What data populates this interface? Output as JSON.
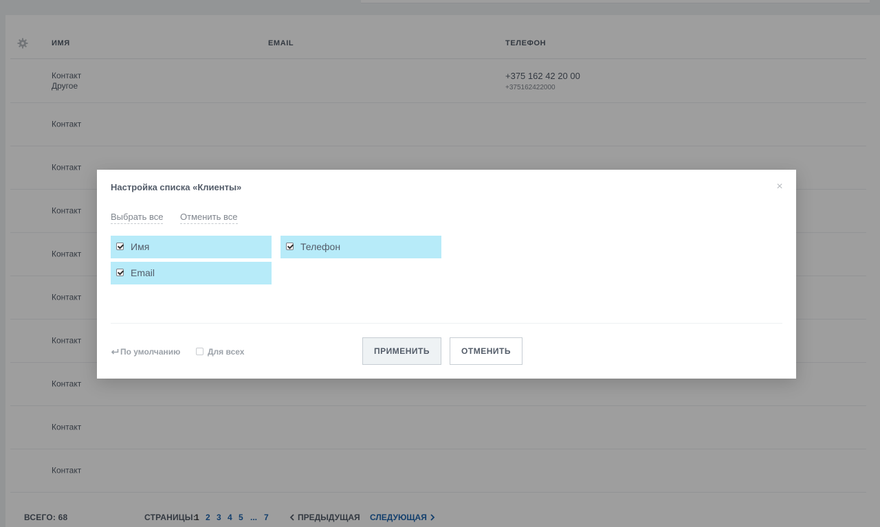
{
  "grid": {
    "columns": {
      "name": "Имя",
      "email": "Email",
      "phone": "Телефон"
    },
    "rows": [
      {
        "name": "Контакт",
        "sub": "Другое",
        "phone": "+375 162 42 20 00",
        "phone_sub": "+375162422000"
      },
      {
        "name": "Контакт"
      },
      {
        "name": "Контакт"
      },
      {
        "name": "Контакт"
      },
      {
        "name": "Контакт"
      },
      {
        "name": "Контакт"
      },
      {
        "name": "Контакт"
      },
      {
        "name": "Контакт"
      },
      {
        "name": "Контакт"
      },
      {
        "name": "Контакт"
      }
    ]
  },
  "footer": {
    "total_label": "ВСЕГО:",
    "total_value": "68",
    "pages_label": "СТРАНИЦЫ:",
    "pages": [
      "1",
      "2",
      "3",
      "4",
      "5",
      "...",
      "7"
    ],
    "current_page": "1",
    "prev": "ПРЕДЫДУЩАЯ",
    "next": "СЛЕДУЮЩАЯ"
  },
  "modal": {
    "title": "Настройка списка «Клиенты»",
    "close": "×",
    "select_all": "Выбрать все",
    "deselect_all": "Отменить все",
    "fields": [
      {
        "label": "Имя",
        "checked": true
      },
      {
        "label": "Телефон",
        "checked": true
      },
      {
        "label": "Email",
        "checked": true
      }
    ],
    "default_link": "По умолчанию",
    "for_all": "Для всех",
    "apply": "Применить",
    "cancel": "Отменить"
  },
  "colors": {
    "chip_bg": "#b7ebf9",
    "link_blue": "#2067b0",
    "text": "#535c69",
    "overlay": "rgba(0,0,0,0.38)"
  }
}
